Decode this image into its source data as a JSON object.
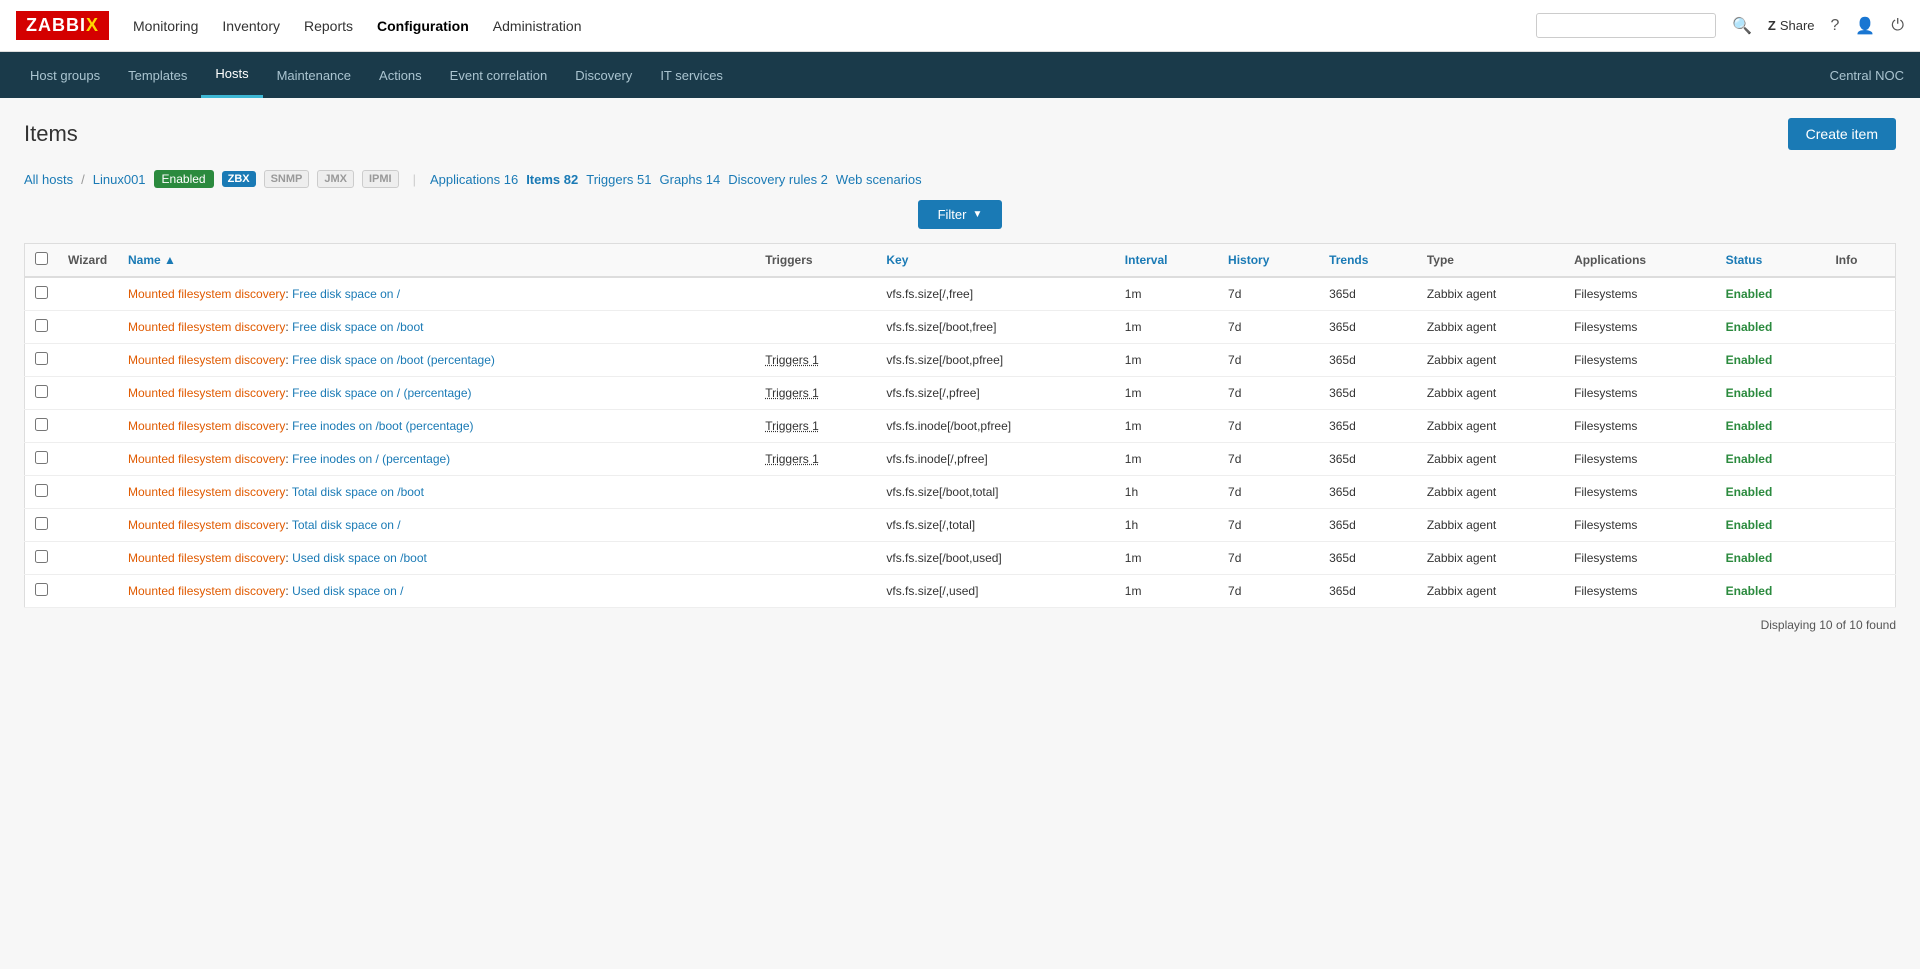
{
  "topnav": {
    "logo": "ZABBIX",
    "links": [
      {
        "label": "Monitoring",
        "active": false
      },
      {
        "label": "Inventory",
        "active": false
      },
      {
        "label": "Reports",
        "active": false
      },
      {
        "label": "Configuration",
        "active": true
      },
      {
        "label": "Administration",
        "active": false
      }
    ],
    "search_placeholder": "",
    "share_label": "Share",
    "user_icon": "👤",
    "power_icon": "⏻",
    "help_icon": "?"
  },
  "subnav": {
    "links": [
      {
        "label": "Host groups",
        "active": false
      },
      {
        "label": "Templates",
        "active": false
      },
      {
        "label": "Hosts",
        "active": true
      },
      {
        "label": "Maintenance",
        "active": false
      },
      {
        "label": "Actions",
        "active": false
      },
      {
        "label": "Event correlation",
        "active": false
      },
      {
        "label": "Discovery",
        "active": false
      },
      {
        "label": "IT services",
        "active": false
      }
    ],
    "context": "Central NOC"
  },
  "page": {
    "title": "Items",
    "create_button": "Create item"
  },
  "breadcrumb": {
    "all_hosts": "All hosts",
    "separator": "/",
    "host": "Linux001",
    "status": "Enabled",
    "tabs": [
      {
        "label": "Applications 16",
        "active": false
      },
      {
        "label": "Items 82",
        "active": true
      },
      {
        "label": "Triggers 51",
        "active": false
      },
      {
        "label": "Graphs 14",
        "active": false
      },
      {
        "label": "Discovery rules 2",
        "active": false
      },
      {
        "label": "Web scenarios",
        "active": false
      }
    ],
    "protocols": [
      "ZBX",
      "SNMP",
      "JMX",
      "IPMI"
    ]
  },
  "filter": {
    "label": "Filter",
    "arrow": "▼"
  },
  "table": {
    "headers": [
      "",
      "Wizard",
      "Name ▲",
      "Triggers",
      "Key",
      "Interval",
      "History",
      "Trends",
      "Type",
      "Applications",
      "Status",
      "Info"
    ],
    "rows": [
      {
        "discovery": "Mounted filesystem discovery",
        "name": "Free disk space on /",
        "triggers": "",
        "key": "vfs.fs.size[/,free]",
        "interval": "1m",
        "history": "7d",
        "trends": "365d",
        "type": "Zabbix agent",
        "applications": "Filesystems",
        "status": "Enabled",
        "info": ""
      },
      {
        "discovery": "Mounted filesystem discovery",
        "name": "Free disk space on /boot",
        "triggers": "",
        "key": "vfs.fs.size[/boot,free]",
        "interval": "1m",
        "history": "7d",
        "trends": "365d",
        "type": "Zabbix agent",
        "applications": "Filesystems",
        "status": "Enabled",
        "info": ""
      },
      {
        "discovery": "Mounted filesystem discovery",
        "name": "Free disk space on /boot (percentage)",
        "triggers": "Triggers 1",
        "key": "vfs.fs.size[/boot,pfree]",
        "interval": "1m",
        "history": "7d",
        "trends": "365d",
        "type": "Zabbix agent",
        "applications": "Filesystems",
        "status": "Enabled",
        "info": ""
      },
      {
        "discovery": "Mounted filesystem discovery",
        "name": "Free disk space on / (percentage)",
        "triggers": "Triggers 1",
        "key": "vfs.fs.size[/,pfree]",
        "interval": "1m",
        "history": "7d",
        "trends": "365d",
        "type": "Zabbix agent",
        "applications": "Filesystems",
        "status": "Enabled",
        "info": ""
      },
      {
        "discovery": "Mounted filesystem discovery",
        "name": "Free inodes on /boot (percentage)",
        "triggers": "Triggers 1",
        "key": "vfs.fs.inode[/boot,pfree]",
        "interval": "1m",
        "history": "7d",
        "trends": "365d",
        "type": "Zabbix agent",
        "applications": "Filesystems",
        "status": "Enabled",
        "info": ""
      },
      {
        "discovery": "Mounted filesystem discovery",
        "name": "Free inodes on / (percentage)",
        "triggers": "Triggers 1",
        "key": "vfs.fs.inode[/,pfree]",
        "interval": "1m",
        "history": "7d",
        "trends": "365d",
        "type": "Zabbix agent",
        "applications": "Filesystems",
        "status": "Enabled",
        "info": ""
      },
      {
        "discovery": "Mounted filesystem discovery",
        "name": "Total disk space on /boot",
        "triggers": "",
        "key": "vfs.fs.size[/boot,total]",
        "interval": "1h",
        "history": "7d",
        "trends": "365d",
        "type": "Zabbix agent",
        "applications": "Filesystems",
        "status": "Enabled",
        "info": ""
      },
      {
        "discovery": "Mounted filesystem discovery",
        "name": "Total disk space on /",
        "triggers": "",
        "key": "vfs.fs.size[/,total]",
        "interval": "1h",
        "history": "7d",
        "trends": "365d",
        "type": "Zabbix agent",
        "applications": "Filesystems",
        "status": "Enabled",
        "info": ""
      },
      {
        "discovery": "Mounted filesystem discovery",
        "name": "Used disk space on /boot",
        "triggers": "",
        "key": "vfs.fs.size[/boot,used]",
        "interval": "1m",
        "history": "7d",
        "trends": "365d",
        "type": "Zabbix agent",
        "applications": "Filesystems",
        "status": "Enabled",
        "info": ""
      },
      {
        "discovery": "Mounted filesystem discovery",
        "name": "Used disk space on /",
        "triggers": "",
        "key": "vfs.fs.size[/,used]",
        "interval": "1m",
        "history": "7d",
        "trends": "365d",
        "type": "Zabbix agent",
        "applications": "Filesystems",
        "status": "Enabled",
        "info": ""
      }
    ],
    "footer": "Displaying 10 of 10 found"
  }
}
